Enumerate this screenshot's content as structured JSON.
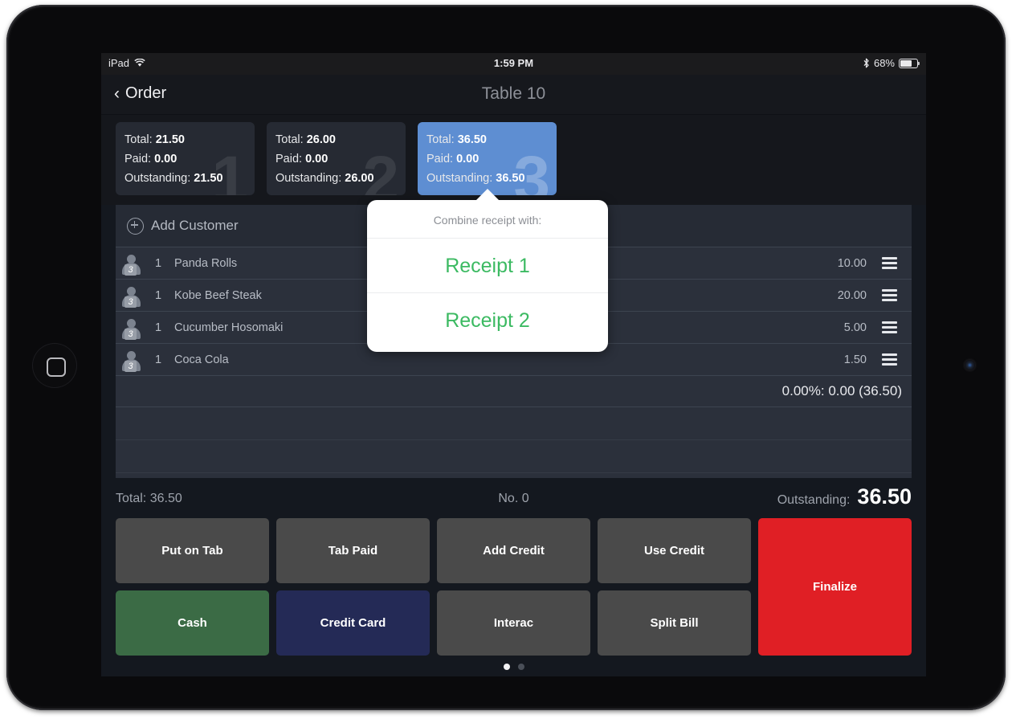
{
  "status_bar": {
    "device": "iPad",
    "wifi_icon": "wifi-icon",
    "time": "1:59 PM",
    "bluetooth_icon": "bluetooth-icon",
    "battery_text": "68%",
    "battery_level": 68
  },
  "nav": {
    "back_chevron": "‹",
    "back_label": "Order",
    "title": "Table 10"
  },
  "receipts": [
    {
      "number": "1",
      "total_label": "Total:",
      "total_value": "21.50",
      "paid_label": "Paid:",
      "paid_value": "0.00",
      "outstanding_label": "Outstanding:",
      "outstanding_value": "21.50",
      "selected": false
    },
    {
      "number": "2",
      "total_label": "Total:",
      "total_value": "26.00",
      "paid_label": "Paid:",
      "paid_value": "0.00",
      "outstanding_label": "Outstanding:",
      "outstanding_value": "26.00",
      "selected": false
    },
    {
      "number": "3",
      "total_label": "Total:",
      "total_value": "36.50",
      "paid_label": "Paid:",
      "paid_value": "0.00",
      "outstanding_label": "Outstanding:",
      "outstanding_value": "36.50",
      "selected": true
    }
  ],
  "add_customer": {
    "icon": "plus-circle-icon",
    "label": "Add Customer"
  },
  "order_items": [
    {
      "seat": "3",
      "qty": "1",
      "name": "Panda Rolls",
      "price": "10.00",
      "menu_icon": "hamburger-menu-icon"
    },
    {
      "seat": "3",
      "qty": "1",
      "name": "Kobe Beef Steak",
      "price": "20.00",
      "menu_icon": "hamburger-menu-icon"
    },
    {
      "seat": "3",
      "qty": "1",
      "name": "Cucumber Hosomaki",
      "price": "5.00",
      "menu_icon": "hamburger-menu-icon"
    },
    {
      "seat": "3",
      "qty": "1",
      "name": "Coca Cola",
      "price": "1.50",
      "menu_icon": "hamburger-menu-icon"
    }
  ],
  "tax_row": "0.00%: 0.00 (36.50)",
  "summary": {
    "total_label": "Total:",
    "total_value": "36.50",
    "number_label": "No. 0",
    "outstanding_label": "Outstanding:",
    "outstanding_value": "36.50"
  },
  "keypad": {
    "put_on_tab": "Put on Tab",
    "tab_paid": "Tab Paid",
    "add_credit": "Add Credit",
    "use_credit": "Use Credit",
    "finalize": "Finalize",
    "cash": "Cash",
    "credit_card": "Credit Card",
    "interac": "Interac",
    "split_bill": "Split Bill"
  },
  "pagination": {
    "total": 2,
    "active_index": 0
  },
  "popover": {
    "title": "Combine receipt with:",
    "options": [
      "Receipt 1",
      "Receipt 2"
    ]
  },
  "colors": {
    "screen_bg": "#14181f",
    "card_bg": "#262a33",
    "card_selected": "#5e8ed2",
    "list_bg": "#2b303b",
    "key_default": "#4a4a4a",
    "key_cash": "#3b6b45",
    "key_credit": "#242a56",
    "key_finalize": "#e01f25",
    "popover_accent": "#3cba62"
  }
}
